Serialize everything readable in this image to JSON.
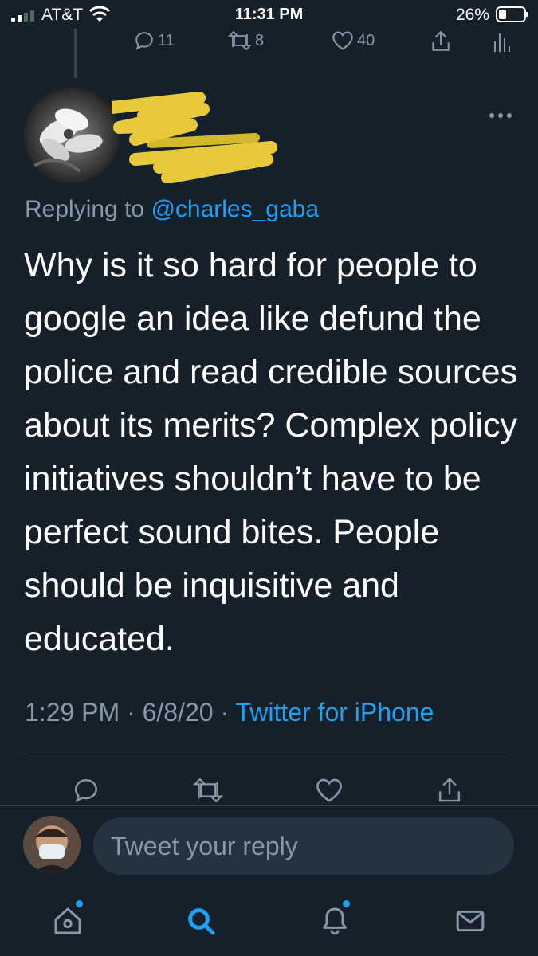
{
  "status_bar": {
    "carrier": "AT&T",
    "time": "11:31 PM",
    "battery": "26%"
  },
  "previous_tweet_actions": {
    "replies": "11",
    "retweets": "8",
    "likes": "40"
  },
  "tweet": {
    "replying_prefix": "Replying to",
    "replying_handle": "@charles_gaba",
    "text": "Why is it so hard for people to google an idea like defund the police and read credible sources about its merits? Complex policy initiatives shouldn’t have to be perfect sound bites. People should be inquisitive and educated.",
    "time": "1:29 PM",
    "date": "6/8/20",
    "separator": "·",
    "source": "Twitter for iPhone"
  },
  "reply_bar": {
    "placeholder": "Tweet your reply"
  },
  "colors": {
    "background": "#15202b",
    "secondary_text": "#8899a6",
    "accent": "#1da1f2",
    "divider": "#38444d"
  },
  "icons": {
    "actions": [
      "reply-icon",
      "retweet-icon",
      "like-icon",
      "share-icon"
    ],
    "nav": [
      "home-icon",
      "search-icon",
      "notifications-icon",
      "messages-icon"
    ]
  }
}
